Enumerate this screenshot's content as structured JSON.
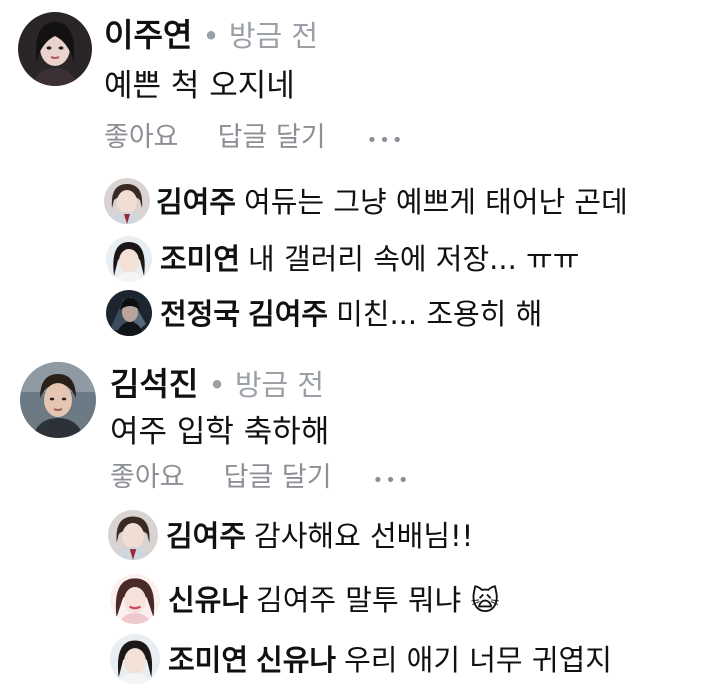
{
  "comments": [
    {
      "author": "이주연",
      "time": "• 방금 전",
      "text": "예쁜 척 오지네",
      "actions": {
        "like": "좋아요",
        "reply": "답글 달기",
        "more": "•••"
      },
      "replies": [
        {
          "author": "김여주",
          "text": "여듀는 그냥 예쁘게 태어난 곤데"
        },
        {
          "author": "조미연",
          "text": "내 갤러리 속에 저장... ㅠㅠ"
        },
        {
          "author": "전정국",
          "mention": "김여주",
          "text": "미친... 조용히 해"
        }
      ]
    },
    {
      "author": "김석진",
      "time": "• 방금 전",
      "text": "여주 입학 축하해",
      "actions": {
        "like": "좋아요",
        "reply": "답글 달기",
        "more": "•••"
      },
      "replies": [
        {
          "author": "김여주",
          "text": "감사해요 선배님!!"
        },
        {
          "author": "신유나",
          "text": "김여주 말투 뭐냐",
          "emoji": "🙀"
        },
        {
          "author": "조미연",
          "mention": "신유나",
          "text": "우리 애기 너무 귀엽지"
        }
      ]
    }
  ]
}
